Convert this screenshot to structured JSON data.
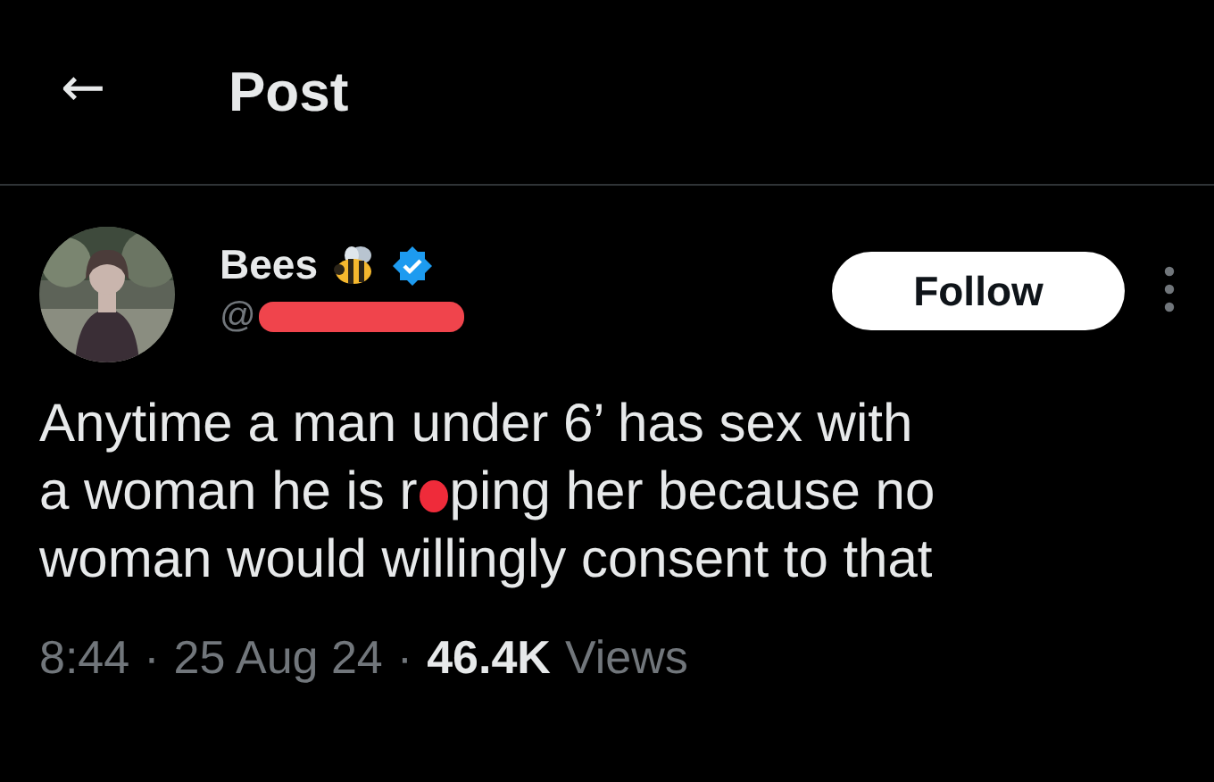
{
  "header": {
    "back_icon": "←",
    "title": "Post"
  },
  "author": {
    "name": "Bees",
    "verified": true,
    "handle_prefix": "@",
    "handle_redacted": true,
    "follow_button": "Follow"
  },
  "body_lines": [
    {
      "segments": [
        {
          "kind": "text",
          "text": "Anytime a man under 6’ has sex with"
        }
      ]
    },
    {
      "segments": [
        {
          "kind": "text",
          "text": "a woman he is r"
        },
        {
          "kind": "redaction"
        },
        {
          "kind": "text",
          "text": "ping her because no"
        }
      ]
    },
    {
      "segments": [
        {
          "kind": "text",
          "text": "woman would willingly consent to that"
        }
      ]
    }
  ],
  "meta": [
    {
      "kind": "text",
      "text": "8:44"
    },
    {
      "kind": "separator",
      "text": "·"
    },
    {
      "kind": "text",
      "text": "25 Aug 24"
    },
    {
      "kind": "separator",
      "text": "·"
    },
    {
      "kind": "count",
      "text": "46.4K"
    },
    {
      "kind": "text",
      "text": "Views"
    }
  ]
}
